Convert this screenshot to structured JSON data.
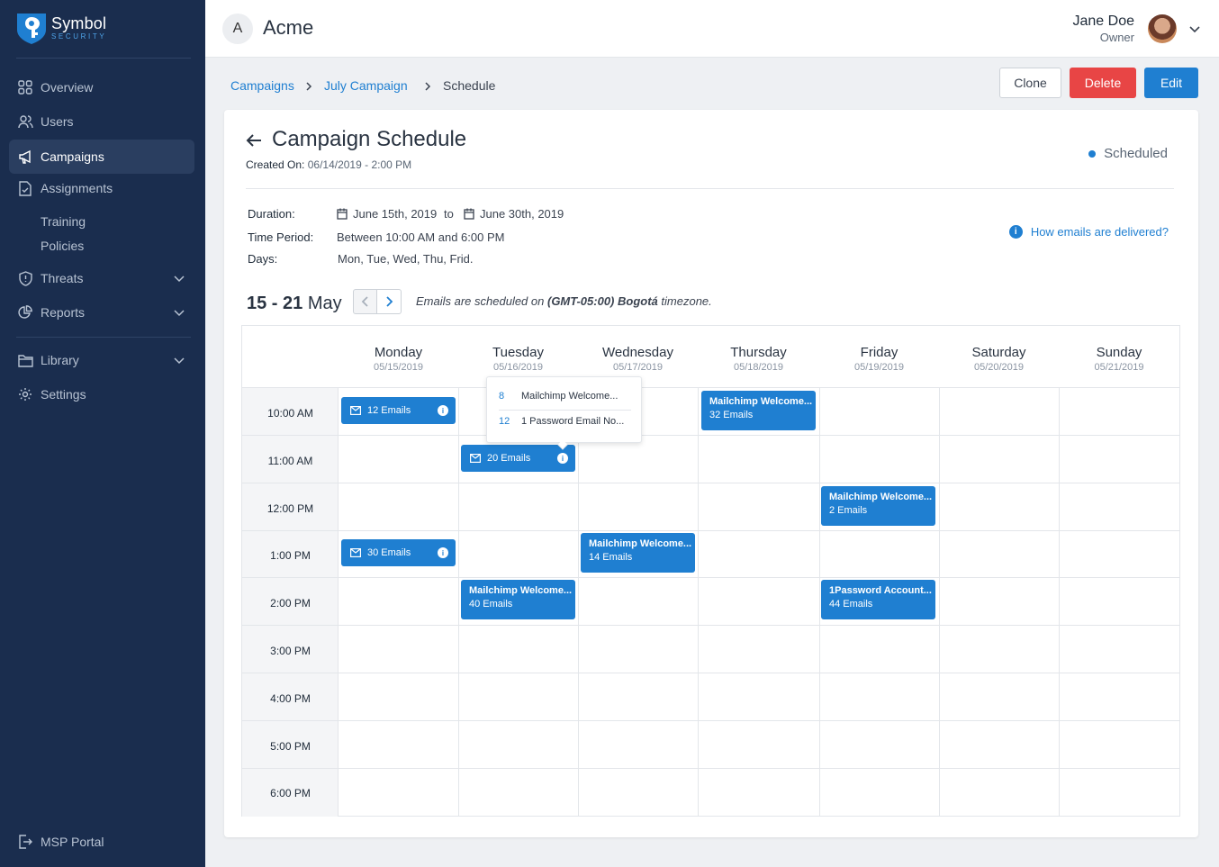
{
  "brand": {
    "name": "Symbol",
    "sub": "SECURITY"
  },
  "sidebar": {
    "items": [
      {
        "label": "Overview",
        "icon": "grid-icon"
      },
      {
        "label": "Users",
        "icon": "users-icon"
      },
      {
        "label": "Campaigns",
        "icon": "megaphone-icon",
        "active": true
      },
      {
        "label": "Assignments",
        "icon": "document-icon"
      },
      {
        "label": "Threats",
        "icon": "shield-icon"
      },
      {
        "label": "Reports",
        "icon": "pie-chart-icon"
      },
      {
        "label": "Library",
        "icon": "folder-icon"
      },
      {
        "label": "Settings",
        "icon": "gear-icon"
      }
    ],
    "sub_items": [
      "Training",
      "Policies"
    ],
    "footer": {
      "label": "MSP Portal",
      "icon": "logout-icon"
    }
  },
  "topbar": {
    "org_initial": "A",
    "org_name": "Acme",
    "user_name": "Jane Doe",
    "user_role": "Owner"
  },
  "breadcrumb": {
    "items": [
      "Campaigns",
      "July Campaign",
      "Schedule"
    ]
  },
  "actions": {
    "clone": "Clone",
    "delete": "Delete",
    "edit": "Edit"
  },
  "header": {
    "title": "Campaign Schedule",
    "created_label": "Created On:",
    "created_value": "06/14/2019 - 2:00 PM",
    "status": "Scheduled"
  },
  "details": {
    "duration_label": "Duration:",
    "start": "June 15th, 2019",
    "to": "to",
    "end": "June 30th, 2019",
    "period_label": "Time Period:",
    "period": "Between 10:00 AM and 6:00 PM",
    "days_label": "Days:",
    "days": "Mon, Tue, Wed, Thu, Frid.",
    "help": "How emails are delivered?"
  },
  "week": {
    "range": "15 - 21",
    "month": "May",
    "tz_prefix": "Emails are scheduled on",
    "tz_zone": "(GMT-05:00) Bogotá",
    "tz_suffix": "timezone."
  },
  "calendar": {
    "days": [
      {
        "name": "Monday",
        "date": "05/15/2019"
      },
      {
        "name": "Tuesday",
        "date": "05/16/2019"
      },
      {
        "name": "Wednesday",
        "date": "05/17/2019"
      },
      {
        "name": "Thursday",
        "date": "05/18/2019"
      },
      {
        "name": "Friday",
        "date": "05/19/2019"
      },
      {
        "name": "Saturday",
        "date": "05/20/2019"
      },
      {
        "name": "Sunday",
        "date": "05/21/2019"
      }
    ],
    "times": [
      "10:00 AM",
      "11:00 AM",
      "12:00 PM",
      "1:00 PM",
      "2:00 PM",
      "3:00 PM",
      "4:00 PM",
      "5:00 PM",
      "6:00 PM"
    ],
    "events": [
      {
        "label": "12 Emails"
      },
      {
        "label": "20 Emails"
      },
      {
        "label": "30 Emails"
      },
      {
        "title": "Mailchimp Welcome...",
        "count": "32 Emails"
      },
      {
        "title": "Mailchimp Welcome...",
        "count": "2 Emails"
      },
      {
        "title": "Mailchimp Welcome...",
        "count": "14 Emails"
      },
      {
        "title": "Mailchimp Welcome...",
        "count": "40 Emails"
      },
      {
        "title": "1Password Account...",
        "count": "44 Emails"
      }
    ],
    "popover": [
      {
        "count": "8",
        "name": "Mailchimp Welcome..."
      },
      {
        "count": "12",
        "name": "1 Password Email No..."
      }
    ]
  },
  "colors": {
    "sidebar_bg": "#1a2d4e",
    "accent": "#1f7fd1",
    "danger": "#e84545"
  }
}
